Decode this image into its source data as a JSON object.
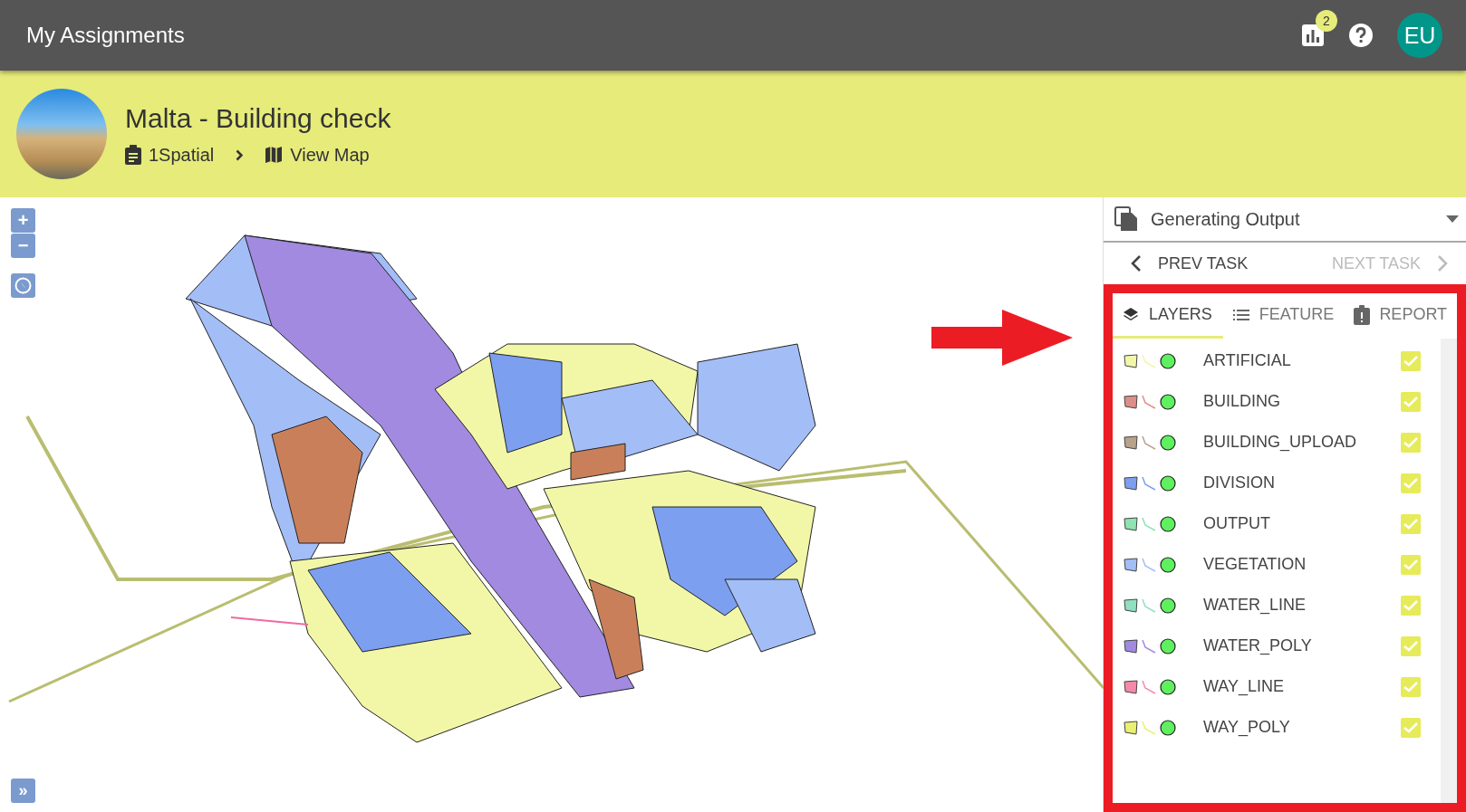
{
  "app_bar": {
    "title": "My Assignments",
    "notification_count": "2",
    "avatar_initials": "EU"
  },
  "project": {
    "title": "Malta - Building check",
    "breadcrumb": [
      "1Spatial",
      "View Map"
    ]
  },
  "map_controls": {
    "zoom_in": "+",
    "zoom_out": "−",
    "expand": "»"
  },
  "task_panel": {
    "task_name": "Generating Output",
    "prev": {
      "label": "PREV TASK",
      "disabled": false
    },
    "next": {
      "label": "NEXT TASK",
      "disabled": true
    },
    "tabs": [
      {
        "label": "LAYERS",
        "selected": true
      },
      {
        "label": "FEATURE",
        "selected": false
      },
      {
        "label": "REPORT",
        "selected": false
      }
    ],
    "layers": [
      {
        "name": "ARTIFICIAL",
        "color": "#f2f7a8",
        "checked": true
      },
      {
        "name": "BUILDING",
        "color": "#de8e88",
        "checked": true
      },
      {
        "name": "BUILDING_UPLOAD",
        "color": "#b8a28a",
        "checked": true
      },
      {
        "name": "DIVISION",
        "color": "#7c9ff0",
        "checked": true
      },
      {
        "name": "OUTPUT",
        "color": "#8ee3b0",
        "checked": true
      },
      {
        "name": "VEGETATION",
        "color": "#a3bdf7",
        "checked": true
      },
      {
        "name": "WATER_LINE",
        "color": "#8fe0c0",
        "checked": true
      },
      {
        "name": "WATER_POLY",
        "color": "#a18ae0",
        "checked": true
      },
      {
        "name": "WAY_LINE",
        "color": "#f48aaa",
        "checked": true
      },
      {
        "name": "WAY_POLY",
        "color": "#eaf070",
        "checked": true
      }
    ]
  }
}
